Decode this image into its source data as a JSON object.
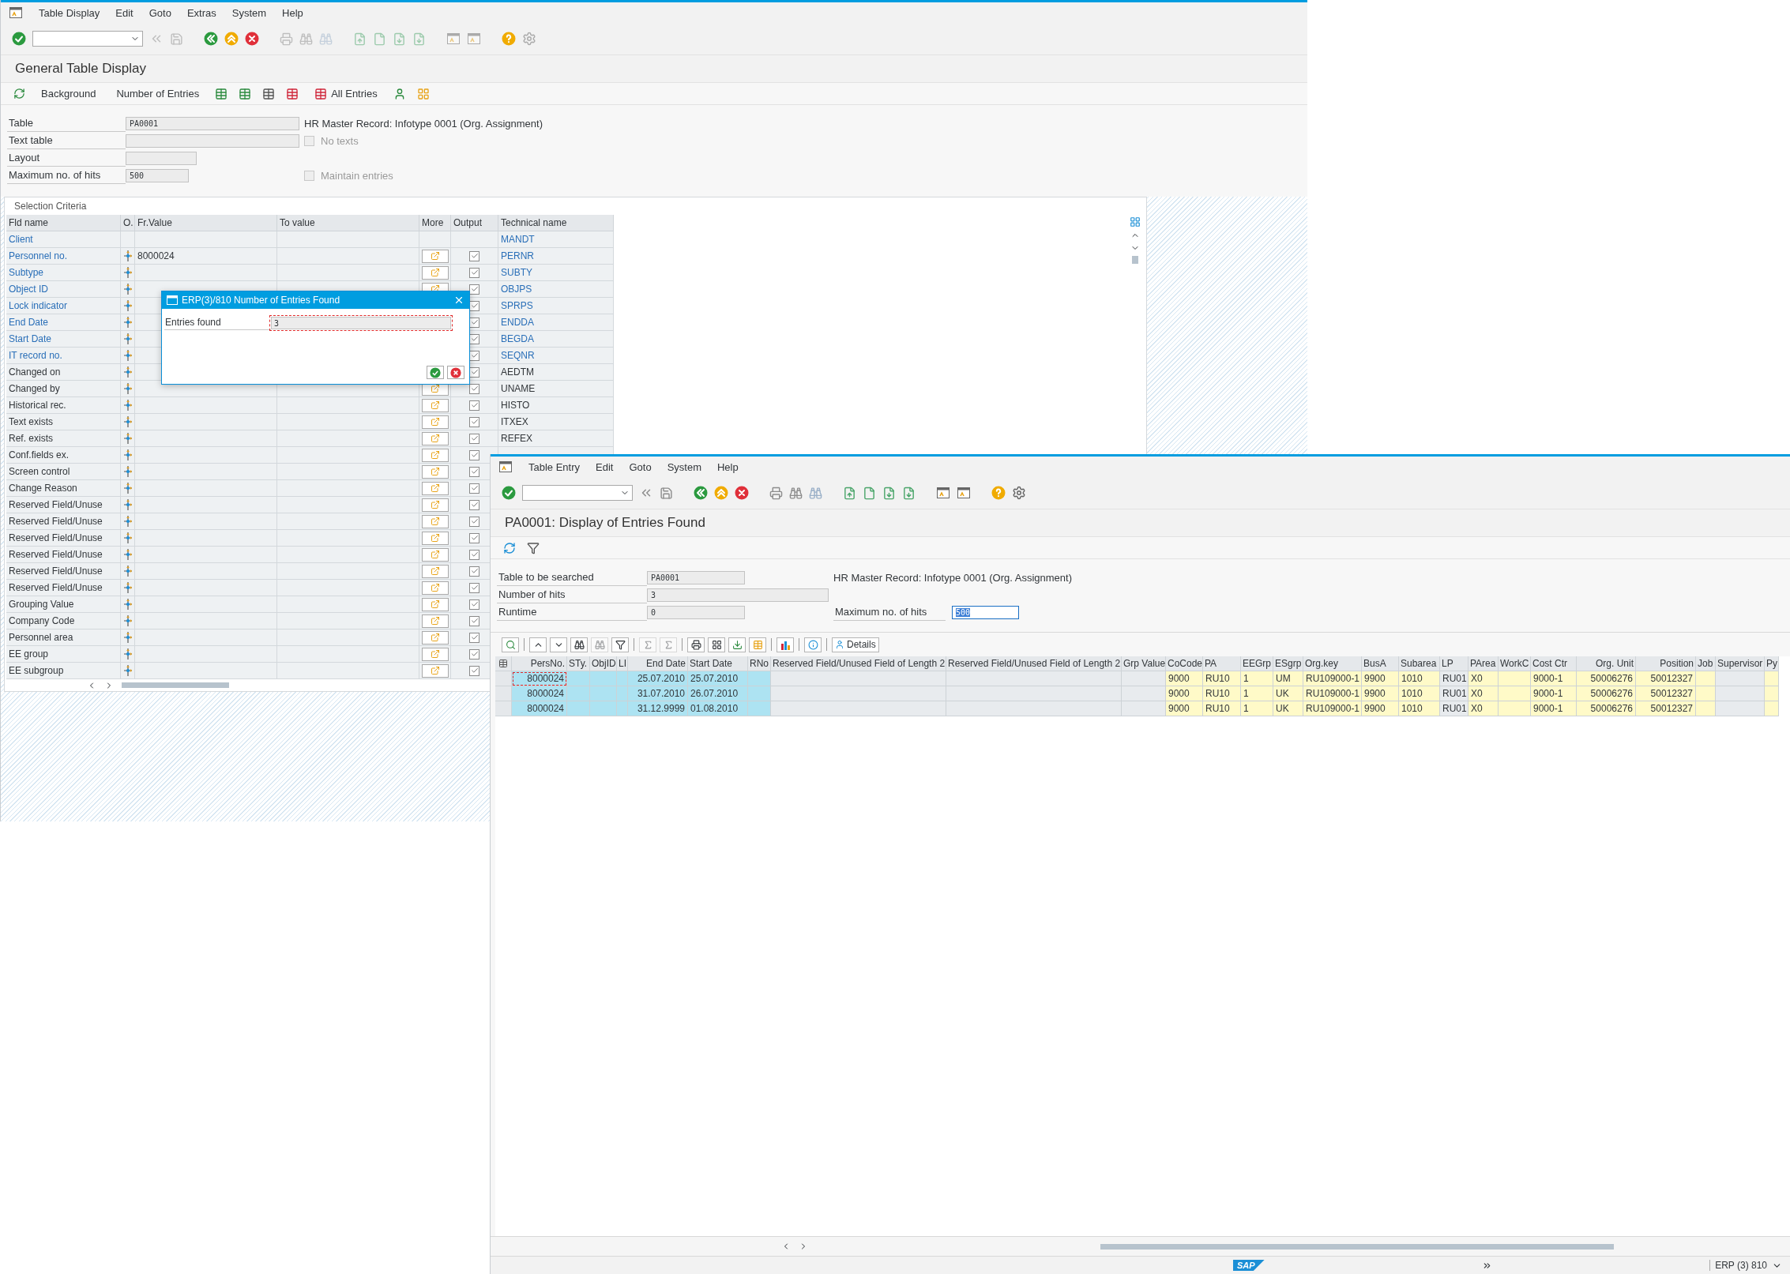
{
  "main_window": {
    "menu": [
      "Table Display",
      "Edit",
      "Goto",
      "Extras",
      "System",
      "Help"
    ],
    "title": "General Table Display",
    "app_toolbar": [
      "Background",
      "Number of Entries",
      "All Entries"
    ],
    "form": {
      "rows": [
        {
          "label": "Table",
          "value": "PA0001",
          "side": {
            "kind": "text",
            "text": "HR Master Record: Infotype 0001 (Org. Assignment)"
          }
        },
        {
          "label": "Text table",
          "side": {
            "kind": "checkbox",
            "label": "No texts",
            "checked": false,
            "disabled": true
          }
        },
        {
          "label": "Layout"
        },
        {
          "label": "Maximum no. of hits",
          "value": "500",
          "side": {
            "kind": "checkbox",
            "label": "Maintain entries",
            "checked": false,
            "disabled": true
          }
        }
      ]
    },
    "selection": {
      "title": "Selection Criteria",
      "columns": [
        "Fld name",
        "O.",
        "Fr.Value",
        "To value",
        "More",
        "Output",
        "Technical name"
      ],
      "rows": [
        {
          "kind": "fixed",
          "name": "Client",
          "key": true,
          "technical": "MANDT"
        },
        {
          "kind": "select",
          "name": "Personnel no.",
          "key": true,
          "from": "8000024",
          "output": true,
          "technical": "PERNR"
        },
        {
          "kind": "select",
          "name": "Subtype",
          "key": true,
          "output": true,
          "technical": "SUBTY"
        },
        {
          "kind": "select",
          "name": "Object ID",
          "key": true,
          "output": true,
          "technical": "OBJPS"
        },
        {
          "kind": "select",
          "name": "Lock indicator",
          "key": true,
          "output": true,
          "technical": "SPRPS"
        },
        {
          "kind": "select",
          "name": "End Date",
          "key": true,
          "output": true,
          "technical": "ENDDA"
        },
        {
          "kind": "select",
          "name": "Start Date",
          "key": true,
          "output": true,
          "technical": "BEGDA"
        },
        {
          "kind": "select",
          "name": "IT record no.",
          "key": true,
          "output": true,
          "technical": "SEQNR"
        },
        {
          "kind": "select",
          "name": "Changed on",
          "key": false,
          "output": true,
          "technical": "AEDTM"
        },
        {
          "kind": "select",
          "name": "Changed by",
          "key": false,
          "output": true,
          "technical": "UNAME"
        },
        {
          "kind": "select",
          "name": "Historical rec.",
          "key": false,
          "output": true,
          "technical": "HISTO"
        },
        {
          "kind": "select",
          "name": "Text exists",
          "key": false,
          "output": true,
          "technical": "ITXEX"
        },
        {
          "kind": "select",
          "name": "Ref. exists",
          "key": false,
          "output": true,
          "technical": "REFEX"
        },
        {
          "kind": "select",
          "name": "Conf.fields ex.",
          "key": false,
          "output": true
        },
        {
          "kind": "select",
          "name": "Screen control",
          "key": false,
          "output": true
        },
        {
          "kind": "select",
          "name": "Change Reason",
          "key": false,
          "output": true
        },
        {
          "kind": "select",
          "name": "Reserved Field/Unuse",
          "key": false,
          "output": true
        },
        {
          "kind": "select",
          "name": "Reserved Field/Unuse",
          "key": false,
          "output": true
        },
        {
          "kind": "select",
          "name": "Reserved Field/Unuse",
          "key": false,
          "output": true
        },
        {
          "kind": "select",
          "name": "Reserved Field/Unuse",
          "key": false,
          "output": true
        },
        {
          "kind": "select",
          "name": "Reserved Field/Unuse",
          "key": false,
          "output": true
        },
        {
          "kind": "select",
          "name": "Reserved Field/Unuse",
          "key": false,
          "output": true
        },
        {
          "kind": "select",
          "name": "Grouping Value",
          "key": false,
          "output": true
        },
        {
          "kind": "select",
          "name": "Company Code",
          "key": false,
          "output": true
        },
        {
          "kind": "select",
          "name": "Personnel area",
          "key": false,
          "output": true
        },
        {
          "kind": "select",
          "name": "EE group",
          "key": false,
          "output": true
        },
        {
          "kind": "select",
          "name": "EE subgroup",
          "key": false,
          "output": true
        }
      ]
    }
  },
  "popup": {
    "title": "ERP(3)/810 Number of Entries Found",
    "label": "Entries found",
    "value": "3"
  },
  "result_window": {
    "menu": [
      "Table Entry",
      "Edit",
      "Goto",
      "System",
      "Help"
    ],
    "title": "PA0001: Display of Entries Found",
    "form": {
      "rows": [
        {
          "label": "Table to be searched",
          "value": "PA0001",
          "side": {
            "kind": "text",
            "text": "HR Master Record: Infotype 0001 (Org. Assignment)"
          }
        },
        {
          "label": "Number of hits",
          "value": "3"
        },
        {
          "label": "Runtime",
          "value": "0",
          "side": {
            "kind": "input",
            "label": "Maximum no. of hits",
            "value": "500"
          }
        }
      ]
    },
    "grid_toolbar": {
      "details": "Details"
    },
    "grid": {
      "columns": [
        {
          "label": "PersNo.",
          "kind": "key",
          "numeric": true
        },
        {
          "label": "STy.",
          "kind": "key"
        },
        {
          "label": "ObjID",
          "kind": "key"
        },
        {
          "label": "LI",
          "kind": "key"
        },
        {
          "label": "End Date",
          "kind": "key",
          "numeric": true
        },
        {
          "label": "Start Date",
          "kind": "key"
        },
        {
          "label": "RNo",
          "kind": "key"
        },
        {
          "label": "Reserved Field/Unused Field of Length 2",
          "kind": "plain"
        },
        {
          "label": "Reserved Field/Unused Field of Length 2",
          "kind": "plain"
        },
        {
          "label": "Grp Value",
          "kind": "plain"
        },
        {
          "label": "CoCode",
          "kind": "value"
        },
        {
          "label": "PA",
          "kind": "value"
        },
        {
          "label": "EEGrp",
          "kind": "value"
        },
        {
          "label": "ESgrp",
          "kind": "value"
        },
        {
          "label": "Org.key",
          "kind": "value"
        },
        {
          "label": "BusA",
          "kind": "value"
        },
        {
          "label": "Subarea",
          "kind": "value"
        },
        {
          "label": "LP",
          "kind": "plain"
        },
        {
          "label": "PArea",
          "kind": "value"
        },
        {
          "label": "WorkC",
          "kind": "value"
        },
        {
          "label": "Cost Ctr",
          "kind": "value"
        },
        {
          "label": "Org. Unit",
          "kind": "value",
          "numeric": true
        },
        {
          "label": "Position",
          "kind": "value",
          "numeric": true
        },
        {
          "label": "Job",
          "kind": "value"
        },
        {
          "label": "Supervisor",
          "kind": "plain"
        },
        {
          "label": "Py",
          "kind": "value"
        }
      ],
      "rows": [
        [
          "8000024",
          null,
          null,
          null,
          "25.07.2010",
          "25.07.2010",
          null,
          null,
          null,
          null,
          "9000",
          "RU10",
          "1",
          "UM",
          "RU109000-1",
          "9900",
          "1010",
          "RU01",
          "X0",
          null,
          "9000-1",
          "50006276",
          "50012327",
          null,
          null,
          null
        ],
        [
          "8000024",
          null,
          null,
          null,
          "31.07.2010",
          "26.07.2010",
          null,
          null,
          null,
          null,
          "9000",
          "RU10",
          "1",
          "UK",
          "RU109000-1",
          "9900",
          "1010",
          "RU01",
          "X0",
          null,
          "9000-1",
          "50006276",
          "50012327",
          null,
          null,
          null
        ],
        [
          "8000024",
          null,
          null,
          null,
          "31.12.9999",
          "01.08.2010",
          null,
          null,
          null,
          null,
          "9000",
          "RU10",
          "1",
          "UK",
          "RU109000-1",
          "9900",
          "1010",
          "RU01",
          "X0",
          null,
          "9000-1",
          "50006276",
          "50012327",
          null,
          null,
          null
        ]
      ]
    },
    "status_bar": {
      "logo": "SAP",
      "system": "ERP (3) 810"
    }
  }
}
